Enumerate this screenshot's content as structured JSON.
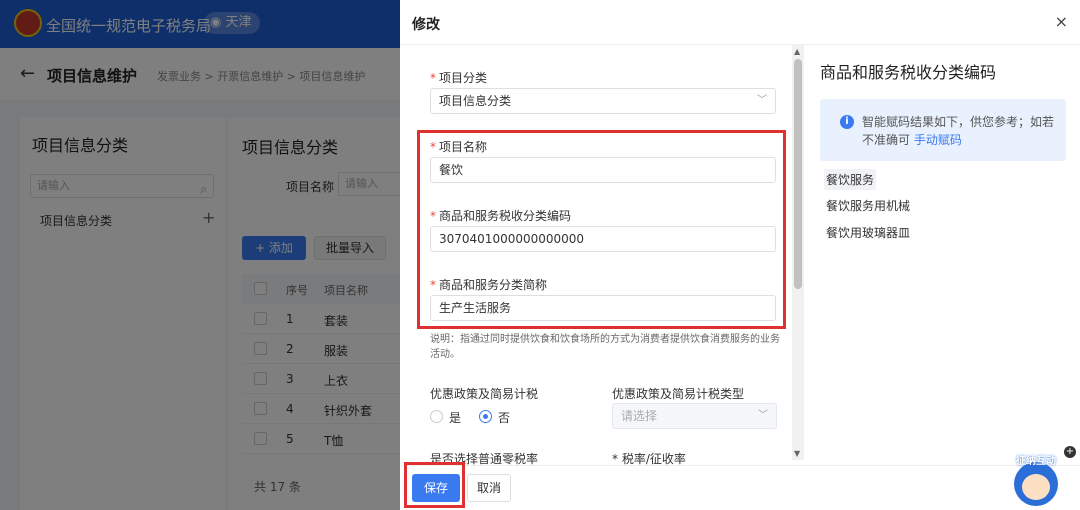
{
  "app": {
    "site_title": "全国统一规范电子税务局",
    "region": "天津",
    "page_title": "项目信息维护",
    "breadcrumbs": "发票业务 > 开票信息维护 > 项目信息维护"
  },
  "left_panel": {
    "title": "项目信息分类",
    "search_placeholder": "请输入",
    "tree_item": "项目信息分类"
  },
  "main_panel": {
    "title": "项目信息分类",
    "filter_label": "项目名称",
    "filter_placeholder": "请输入",
    "add_label": "+ 添加",
    "batch_import_label": "批量导入",
    "columns": [
      "序号",
      "项目名称"
    ],
    "rows": [
      {
        "index": "1",
        "name": "套装"
      },
      {
        "index": "2",
        "name": "服装"
      },
      {
        "index": "3",
        "name": "上衣"
      },
      {
        "index": "4",
        "name": "针织外套"
      },
      {
        "index": "5",
        "name": "T恤"
      }
    ],
    "total": "共 17 条"
  },
  "drawer": {
    "title": "修改",
    "close": "×",
    "fields": {
      "category": {
        "label": "项目分类",
        "value": "项目信息分类"
      },
      "name": {
        "label": "项目名称",
        "value": "餐饮"
      },
      "tax_code": {
        "label": "商品和服务税收分类编码",
        "value": "3070401000000000000"
      },
      "short_name": {
        "label": "商品和服务分类简称",
        "value": "生产生活服务"
      }
    },
    "note": "说明：指通过同时提供饮食和饮食场所的方式为消费者提供饮食消费服务的业务活动。",
    "preferential": {
      "label": "优惠政策及简易计税",
      "options": [
        "是",
        "否"
      ],
      "selected": "否"
    },
    "preferential_type": {
      "label": "优惠政策及简易计税类型",
      "placeholder": "请选择"
    },
    "cut_labels": [
      "是否选择普通零税率",
      "* 税率/征收率"
    ],
    "save_label": "保存",
    "cancel_label": "取消"
  },
  "code_panel": {
    "title": "商品和服务税收分类编码",
    "info_text": "智能赋码结果如下，供您参考；如若不准确可",
    "info_link": "手动赋码",
    "results": [
      "餐饮服务",
      "餐饮服务用机械",
      "餐饮用玻璃器皿"
    ]
  },
  "mascot": {
    "label": "征纳互动"
  },
  "colors": {
    "primary": "#3a7af0",
    "highlight": "#e03030",
    "header": "#1f5fd6"
  }
}
